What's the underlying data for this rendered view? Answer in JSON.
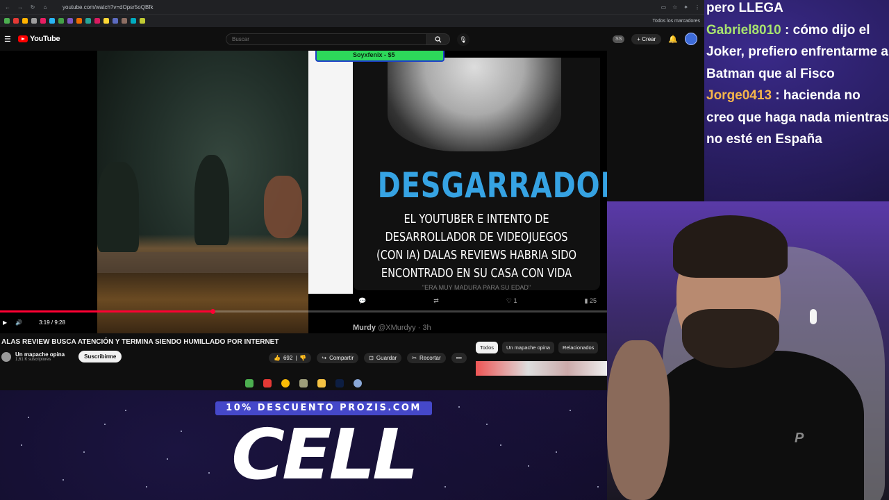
{
  "browser": {
    "url": "youtube.com/watch?v=dOpsr5oQBfk",
    "bookmarks_label": "Todos los marcadores"
  },
  "youtube": {
    "logo_text": "YouTube",
    "search_placeholder": "Buscar",
    "create_label": "Crear",
    "ss_badge": "SS"
  },
  "player": {
    "time": "3:19 / 9:28",
    "progress": 0.35,
    "donation": "Soyxfenix - $5",
    "headline": "DESGARRADOR",
    "subline": "EL YOUTUBER E INTENTO DE DESARROLLADOR DE VIDEOJUEGOS (CON IA) DALAS REVIEWS HABRIA SIDO ENCONTRADO EN SU CASA CON VIDA",
    "quote": "\"ERA MUY MADURA PARA SU EDAD\"",
    "likes_tweet": "1",
    "views_tweet": "25",
    "next_tweet_user": "Murdy",
    "next_tweet_handle": "@XMurdyy · 3h"
  },
  "video": {
    "title": "ALAS REVIEW BUSCA ATENCIÓN Y TERMINA SIENDO HUMILLADO POR INTERNET",
    "channel": "Un mapache opina",
    "subscribers": "1,61 K suscriptores",
    "subscribe_label": "Suscribirme",
    "likes": "692",
    "share_label": "Compartir",
    "save_label": "Guardar",
    "clip_label": "Recortar",
    "more_label": "•••"
  },
  "chips": [
    "Todos",
    "Un mapache opina",
    "Relacionados"
  ],
  "promo": {
    "bar": "10% DESCUENTO PROZIS.COM",
    "big": "CELL"
  },
  "chat": [
    {
      "user": "",
      "msg": "pero LLEGA"
    },
    {
      "user": "Gabriel8010",
      "msg": ": cómo dijo el Joker, prefiero enfrentarme a Batman que al Fisco",
      "color": "#a8e36e"
    },
    {
      "user": "Jorge0413",
      "msg": ": hacienda no creo que haga nada mientras no esté en España",
      "color": "#f5b54a"
    }
  ]
}
